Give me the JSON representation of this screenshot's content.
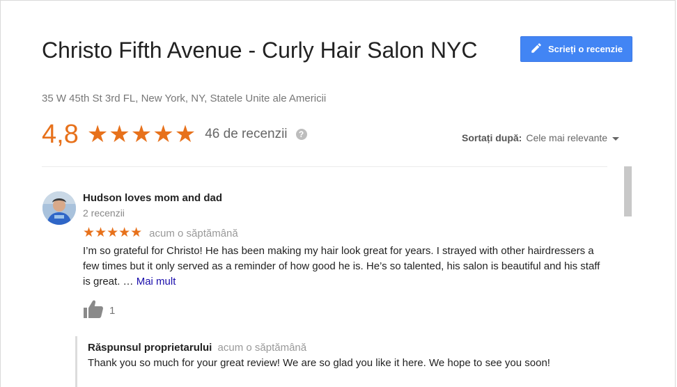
{
  "place": {
    "name": "Christo Fifth Avenue - Curly Hair Salon NYC",
    "address": "35 W 45th St 3rd FL, New York, NY, Statele Unite ale Americii"
  },
  "actions": {
    "write_review_label": "Scrieți o recenzie",
    "write_review_icon": "pencil-icon"
  },
  "rating": {
    "value": "4,8",
    "stars": "★★★★★",
    "star_count": 5,
    "review_count": "46 de recenzii",
    "help_icon": "?"
  },
  "sort": {
    "label": "Sortați după:",
    "value": "Cele mai relevante"
  },
  "review": {
    "author": "Hudson loves mom and dad",
    "author_reviews": "2 recenzii",
    "stars": "★★★★★",
    "star_count": 5,
    "date": "acum o săptămână",
    "text": "I’m so grateful for Christo! He has been making my hair look great for years. I strayed with other hairdressers a few times but it only served as a reminder of how good he is. He’s so talented, his salon is beautiful and his staff is great. …",
    "more_link": "Mai mult",
    "likes": "1",
    "owner_reply": {
      "label": "Răspunsul proprietarului",
      "date": "acum o săptămână",
      "text": "Thank you so much for your great review! We are so glad you like it here. We hope to see you soon!"
    }
  },
  "colors": {
    "accent_orange": "#e7711b",
    "button_blue": "#4285f4",
    "link_blue": "#1a0dab"
  }
}
